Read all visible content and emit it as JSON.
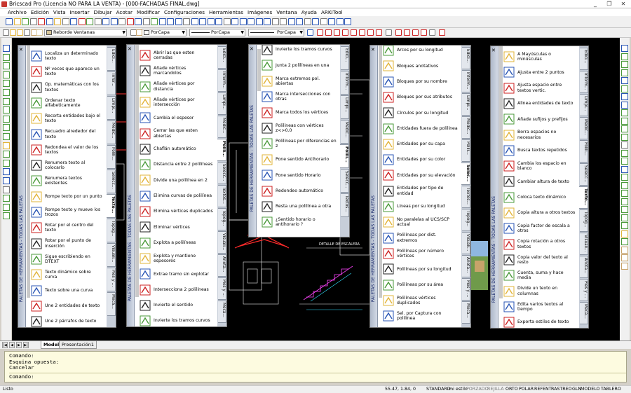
{
  "window": {
    "title": "Bricscad Pro (Licencia NO PARA LA VENTA) - [000-FACHADAS FINAL.dwg]",
    "controls": [
      "_",
      "❐",
      "✕"
    ]
  },
  "menu": [
    "Archivo",
    "Edición",
    "Vista",
    "Insertar",
    "Dibujar",
    "Acotar",
    "Modificar",
    "Configuraciones",
    "Herramientas",
    "Imágenes",
    "Ventana",
    "Ayuda",
    "ARKITool"
  ],
  "props_bar": {
    "layer": "Reborde Ventanas",
    "color": "PorCapa",
    "linetype": "PorCapa",
    "lineweight": "PorCapa"
  },
  "palette_header": "PALETAS DE HERRAMIENTAS - TODAS LAS PALETAS",
  "palettes": [
    {
      "items": [
        "Localiza un determinado texto",
        "Nº veces que aparece un texto",
        "Op. matemáticas con los textos",
        "Ordenar texto alfabeticamente",
        "Recorta entidades bajo el texto",
        "Recuadro alrededor del texto",
        "Redondea el valor de los textos",
        "Renumera texto al colocarlo",
        "Renumera textos existentes",
        "Rompe texto por un punto",
        "Rompe texto y mueve los trozos",
        "Rotar por el centro del texto",
        "Rotar por el punto de inserción",
        "Sigue escribiendo en DTEXT",
        "Texto dinámico sobre curva",
        "Texto sobre una curva",
        "Une 2 entidades de texto",
        "Une 2 párrafos de texto"
      ],
      "tabs": [
        "Edici...",
        "Infor...",
        "Limpi...",
        "Medic...",
        "Polilí...",
        "Selecc...",
        "Texto...",
        "Topog...",
        "Visuali...",
        "Pies y ...",
        "Mecá..."
      ],
      "selected": 6
    },
    {
      "items": [
        "Abrir las que esten cerradas",
        "Añade vértices marcandolos",
        "Añade vértices por distancia",
        "Añade vértices por intersección",
        "Cambia el espesor",
        "Cerrar las que esten abiertas",
        "Chaflán automático",
        "Distancia entre 2 polilíneas",
        "Divide una polilínea en 2",
        "Elimina curvas de polilínea",
        "Elimina vértices duplicados",
        "Eliminar vértices",
        "Explota a polilíneas",
        "Explota y mantiene espesores",
        "Extrae tramo sin explotar",
        "Intersecciona 2 polilíneas",
        "Invierte el sentido",
        "Invierte los tramos curvos"
      ],
      "tabs": [
        "Edici...",
        "Inform...",
        "Limpi...",
        "Medic...",
        "Polilí...",
        "Selecc...",
        "Textos...",
        "Topog...",
        "Visuali...",
        "Anota...",
        "Pies y ...",
        "Mecá..."
      ],
      "selected": 4
    },
    {
      "items": [
        "Invierte los tramos curvos",
        "Junta 2 polilíneas en una",
        "Marca extremos pol. abiertas",
        "Marca intersecciones con otras",
        "Marca todos los vértices",
        "Polilíneas con vértices z<>0.0",
        "Polilíneas por diferencias en z",
        "Pone sentido Antihorario",
        "Pone sentido Horario",
        "Redondeo automático",
        "Resta una polilínea a otra",
        "¿Sentido horario o antihorario ?"
      ],
      "tabs": [
        "Edici...",
        "Inform...",
        "Limpi...",
        "Medic...",
        "Polilí...",
        "Selecc...",
        "Textos..."
      ],
      "selected": 4
    },
    {
      "items": [
        "Arcos por su longitud",
        "Bloques anotativos",
        "Bloques por su nombre",
        "Bloques por sus atributos",
        "Círculos por su longitud",
        "Entidades fuera de polilínea",
        "Entidades por su capa",
        "Entidades por su color",
        "Entidades por su elevación",
        "Entidades por tipo de entidad",
        "Líneas por su longitud",
        "No paralelas al UCS/SCP actual",
        "Polilíneas por dist. extremos",
        "Polilíneas por número vértices",
        "Polilíneas por su longitud",
        "Polilíneas por su área",
        "Polilíneas vértices duplicados",
        "Sel. por Captura con polilínea"
      ],
      "tabs": [
        "Edici...",
        "Inform...",
        "Limpi...",
        "Medic...",
        "Polilí...",
        "Selec...",
        "Textos...",
        "Topog...",
        "Visuali...",
        "Anota...",
        "Pies y ...",
        "Mecá..."
      ],
      "selected": 5
    },
    {
      "items": [
        "A Mayúsculas o minúsculas",
        "Ajusta entre 2 puntos",
        "Ajusta espacio entre textos vertic.",
        "Alinea entidades de texto",
        "Añade sufijos y prefijos",
        "Borra espacios no necesarios",
        "Busca textos repetidos",
        "Cambia los espacio en blanco",
        "Cambiar altura de texto",
        "Coloca texto dinámico",
        "Copia altura a otros textos",
        "Copia factor de escala a otros",
        "Copia rotación a otros textos",
        "Copia valor del texto al resto",
        "Cuenta, suma y hace media",
        "Divide un texto en columnas",
        "Edita varios textos al tiempo",
        "Exporta estilos de texto"
      ],
      "tabs": [
        "Edici...",
        "Inform...",
        "Limpi...",
        "Medic...",
        "Polilí...",
        "Selecc...",
        "Texto...",
        "Topog...",
        "Visuali...",
        "Anota...",
        "Pies y ...",
        "Mecá..."
      ],
      "selected": 6
    }
  ],
  "layout_tabs": [
    "Model",
    "Presentación1"
  ],
  "drawing_label": "DETALLE DE ESCALERA",
  "command_history": [
    "Comando:",
    "Esquina opuesta:",
    "Cancelar"
  ],
  "command_prompt": "Comando:",
  "status": {
    "left": "Listo",
    "coords": "55.47, 1.84, 0",
    "standard": "STANDARD",
    "style": "mi estilo",
    "toggles": [
      "PORZADO",
      "REJILLA",
      "ORTO",
      "POLAR",
      "REFENT",
      "RASTREO",
      "GLN",
      "MODELO",
      "TABLERO"
    ]
  },
  "colors": {
    "canvas": "#000000",
    "accent": "#1a2a6c",
    "cmd_bg": "#fdfbe0",
    "icon_blue": "#2a56b5",
    "icon_red": "#cc2222"
  }
}
